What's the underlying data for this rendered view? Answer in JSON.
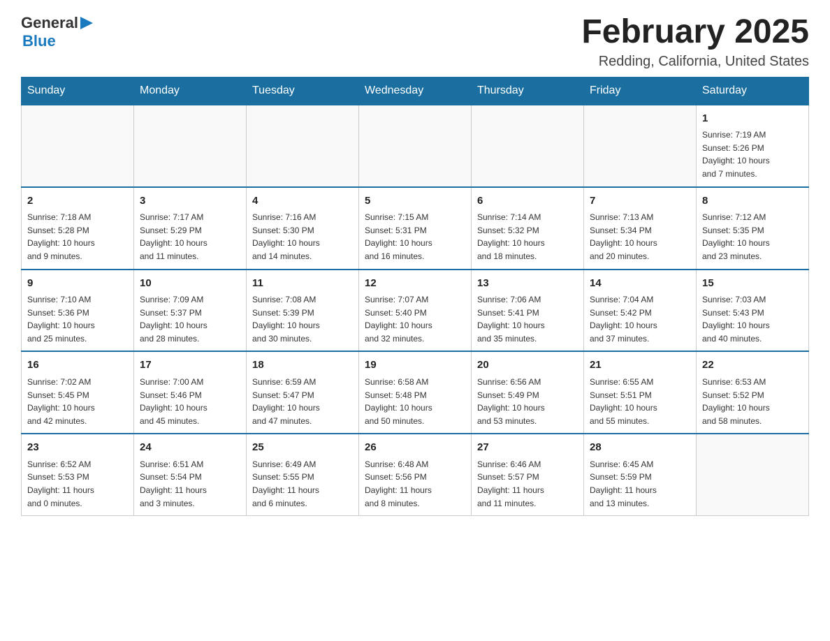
{
  "header": {
    "logo_general": "General",
    "logo_blue": "Blue",
    "month_title": "February 2025",
    "location": "Redding, California, United States"
  },
  "days_of_week": [
    "Sunday",
    "Monday",
    "Tuesday",
    "Wednesday",
    "Thursday",
    "Friday",
    "Saturday"
  ],
  "weeks": [
    [
      {
        "day": "",
        "info": ""
      },
      {
        "day": "",
        "info": ""
      },
      {
        "day": "",
        "info": ""
      },
      {
        "day": "",
        "info": ""
      },
      {
        "day": "",
        "info": ""
      },
      {
        "day": "",
        "info": ""
      },
      {
        "day": "1",
        "info": "Sunrise: 7:19 AM\nSunset: 5:26 PM\nDaylight: 10 hours\nand 7 minutes."
      }
    ],
    [
      {
        "day": "2",
        "info": "Sunrise: 7:18 AM\nSunset: 5:28 PM\nDaylight: 10 hours\nand 9 minutes."
      },
      {
        "day": "3",
        "info": "Sunrise: 7:17 AM\nSunset: 5:29 PM\nDaylight: 10 hours\nand 11 minutes."
      },
      {
        "day": "4",
        "info": "Sunrise: 7:16 AM\nSunset: 5:30 PM\nDaylight: 10 hours\nand 14 minutes."
      },
      {
        "day": "5",
        "info": "Sunrise: 7:15 AM\nSunset: 5:31 PM\nDaylight: 10 hours\nand 16 minutes."
      },
      {
        "day": "6",
        "info": "Sunrise: 7:14 AM\nSunset: 5:32 PM\nDaylight: 10 hours\nand 18 minutes."
      },
      {
        "day": "7",
        "info": "Sunrise: 7:13 AM\nSunset: 5:34 PM\nDaylight: 10 hours\nand 20 minutes."
      },
      {
        "day": "8",
        "info": "Sunrise: 7:12 AM\nSunset: 5:35 PM\nDaylight: 10 hours\nand 23 minutes."
      }
    ],
    [
      {
        "day": "9",
        "info": "Sunrise: 7:10 AM\nSunset: 5:36 PM\nDaylight: 10 hours\nand 25 minutes."
      },
      {
        "day": "10",
        "info": "Sunrise: 7:09 AM\nSunset: 5:37 PM\nDaylight: 10 hours\nand 28 minutes."
      },
      {
        "day": "11",
        "info": "Sunrise: 7:08 AM\nSunset: 5:39 PM\nDaylight: 10 hours\nand 30 minutes."
      },
      {
        "day": "12",
        "info": "Sunrise: 7:07 AM\nSunset: 5:40 PM\nDaylight: 10 hours\nand 32 minutes."
      },
      {
        "day": "13",
        "info": "Sunrise: 7:06 AM\nSunset: 5:41 PM\nDaylight: 10 hours\nand 35 minutes."
      },
      {
        "day": "14",
        "info": "Sunrise: 7:04 AM\nSunset: 5:42 PM\nDaylight: 10 hours\nand 37 minutes."
      },
      {
        "day": "15",
        "info": "Sunrise: 7:03 AM\nSunset: 5:43 PM\nDaylight: 10 hours\nand 40 minutes."
      }
    ],
    [
      {
        "day": "16",
        "info": "Sunrise: 7:02 AM\nSunset: 5:45 PM\nDaylight: 10 hours\nand 42 minutes."
      },
      {
        "day": "17",
        "info": "Sunrise: 7:00 AM\nSunset: 5:46 PM\nDaylight: 10 hours\nand 45 minutes."
      },
      {
        "day": "18",
        "info": "Sunrise: 6:59 AM\nSunset: 5:47 PM\nDaylight: 10 hours\nand 47 minutes."
      },
      {
        "day": "19",
        "info": "Sunrise: 6:58 AM\nSunset: 5:48 PM\nDaylight: 10 hours\nand 50 minutes."
      },
      {
        "day": "20",
        "info": "Sunrise: 6:56 AM\nSunset: 5:49 PM\nDaylight: 10 hours\nand 53 minutes."
      },
      {
        "day": "21",
        "info": "Sunrise: 6:55 AM\nSunset: 5:51 PM\nDaylight: 10 hours\nand 55 minutes."
      },
      {
        "day": "22",
        "info": "Sunrise: 6:53 AM\nSunset: 5:52 PM\nDaylight: 10 hours\nand 58 minutes."
      }
    ],
    [
      {
        "day": "23",
        "info": "Sunrise: 6:52 AM\nSunset: 5:53 PM\nDaylight: 11 hours\nand 0 minutes."
      },
      {
        "day": "24",
        "info": "Sunrise: 6:51 AM\nSunset: 5:54 PM\nDaylight: 11 hours\nand 3 minutes."
      },
      {
        "day": "25",
        "info": "Sunrise: 6:49 AM\nSunset: 5:55 PM\nDaylight: 11 hours\nand 6 minutes."
      },
      {
        "day": "26",
        "info": "Sunrise: 6:48 AM\nSunset: 5:56 PM\nDaylight: 11 hours\nand 8 minutes."
      },
      {
        "day": "27",
        "info": "Sunrise: 6:46 AM\nSunset: 5:57 PM\nDaylight: 11 hours\nand 11 minutes."
      },
      {
        "day": "28",
        "info": "Sunrise: 6:45 AM\nSunset: 5:59 PM\nDaylight: 11 hours\nand 13 minutes."
      },
      {
        "day": "",
        "info": ""
      }
    ]
  ]
}
